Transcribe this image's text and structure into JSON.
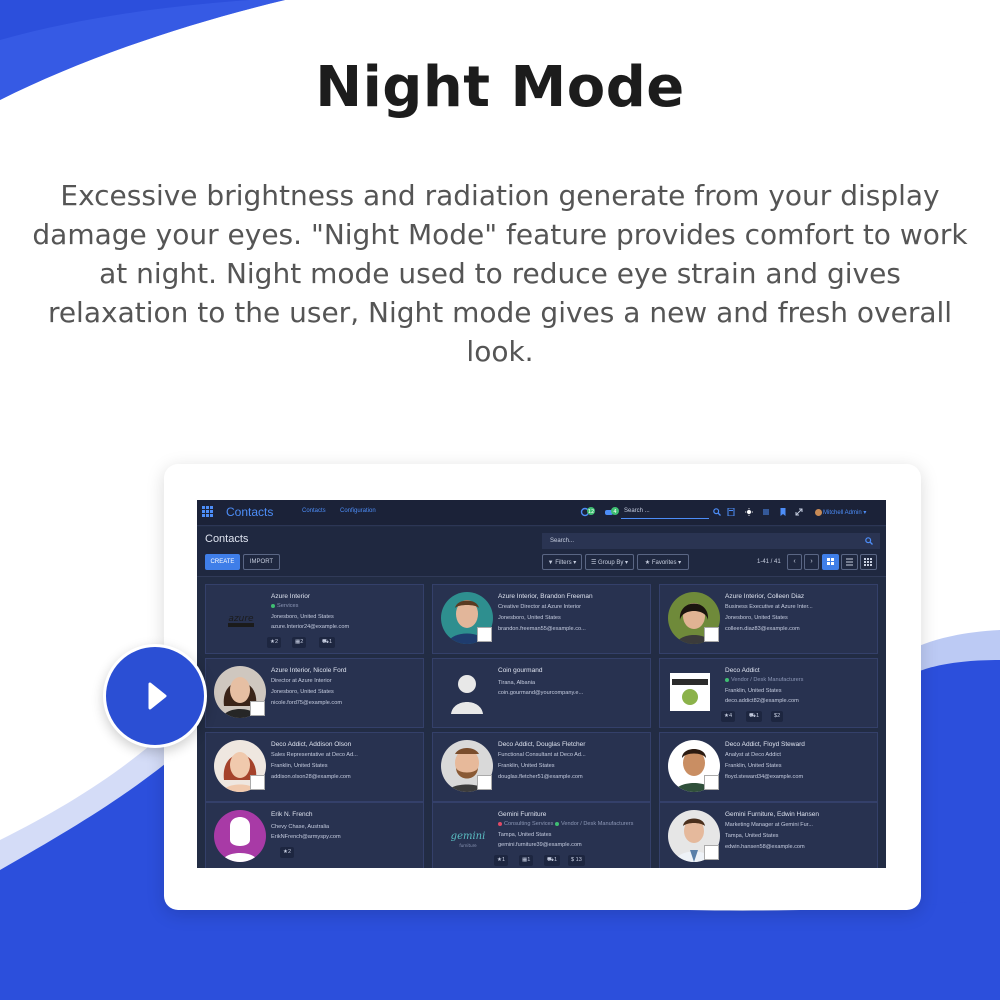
{
  "heading": "Night Mode",
  "description": "Excessive brightness and radiation generate from your display damage your eyes. \"Night Mode\" feature provides comfort to work at night. Night mode used to reduce eye strain and gives relaxation to the user, Night mode gives a new and fresh overall look.",
  "colors": {
    "accent": "#2b4fd4",
    "screen_bg": "#222c44",
    "link": "#4d8df7"
  },
  "app": {
    "brand": "Contacts",
    "menu": [
      "Contacts",
      "Configuration"
    ],
    "chat_count": "12",
    "activity_count": "4",
    "search_placeholder": "Search ...",
    "user": "Mitchell Admin"
  },
  "control_panel": {
    "breadcrumb": "Contacts",
    "create": "CREATE",
    "import": "IMPORT",
    "search_placeholder": "Search...",
    "filters": "Filters",
    "group_by": "Group By",
    "favorites": "Favorites",
    "pager": "1-41 / 41"
  },
  "contacts": [
    {
      "name": "Azure Interior",
      "tag": "Services",
      "lines": [
        "Jonesboro, United States",
        "azure.Interior24@example.com"
      ],
      "badges": [
        "★2",
        "▦2",
        "⛟1"
      ],
      "photo": "azure-logo"
    },
    {
      "name": "Azure Interior, Brandon Freeman",
      "lines": [
        "Creative Director at Azure Interior",
        "Jonesboro, United States",
        "brandon.freeman55@example.co..."
      ],
      "photo": "person-teal"
    },
    {
      "name": "Azure Interior, Colleen Diaz",
      "lines": [
        "Business Executive at Azure Inter...",
        "Jonesboro, United States",
        "colleen.diaz83@example.com"
      ],
      "photo": "person-green"
    },
    {
      "name": "Azure Interior, Nicole Ford",
      "lines": [
        "Director at Azure Interior",
        "Jonesboro, United States",
        "nicole.ford75@example.com"
      ],
      "photo": "person-dark"
    },
    {
      "name": "Coin gourmand",
      "lines": [
        "Tirana, Albania",
        "coin.gourmand@yourcompany.e..."
      ],
      "photo": "placeholder"
    },
    {
      "name": "Deco Addict",
      "tag": "Vendor / Desk Manufacturers",
      "lines": [
        "Franklin, United States",
        "deco.addict82@example.com"
      ],
      "badges": [
        "★4",
        "⛟1",
        "$2"
      ],
      "photo": "deco-logo"
    },
    {
      "name": "Deco Addict, Addison Olson",
      "lines": [
        "Sales Representative at Deco Ad...",
        "Franklin, United States",
        "addison.olson28@example.com"
      ],
      "photo": "person-red"
    },
    {
      "name": "Deco Addict, Douglas Fletcher",
      "lines": [
        "Functional Consultant at Deco Ad...",
        "Franklin, United States",
        "douglas.fletcher51@example.com"
      ],
      "photo": "person-beard"
    },
    {
      "name": "Deco Addict, Floyd Steward",
      "lines": [
        "Analyst at Deco Addict",
        "Franklin, United States",
        "floyd.steward34@example.com"
      ],
      "photo": "person-smile"
    },
    {
      "name": "Erik N. French",
      "lines": [
        "Chevy Chase, Australia",
        "ErikNFrench@armyspy.com"
      ],
      "badges": [
        "★2"
      ],
      "photo": "mask"
    },
    {
      "name": "Gemini Furniture",
      "tag": "Consulting Services",
      "tag2": "Vendor / Desk Manufacturers",
      "lines": [
        "Tampa, United States",
        "gemini.furniture39@example.com"
      ],
      "badges": [
        "★1",
        "▦1",
        "⛟1",
        "$ 13"
      ],
      "photo": "gemini-logo",
      "logo_text": "gemini"
    },
    {
      "name": "Gemini Furniture, Edwin Hansen",
      "lines": [
        "Marketing Manager at Gemini Fur...",
        "Tampa, United States",
        "edwin.hansen58@example.com"
      ],
      "photo": "person-shirt"
    }
  ]
}
